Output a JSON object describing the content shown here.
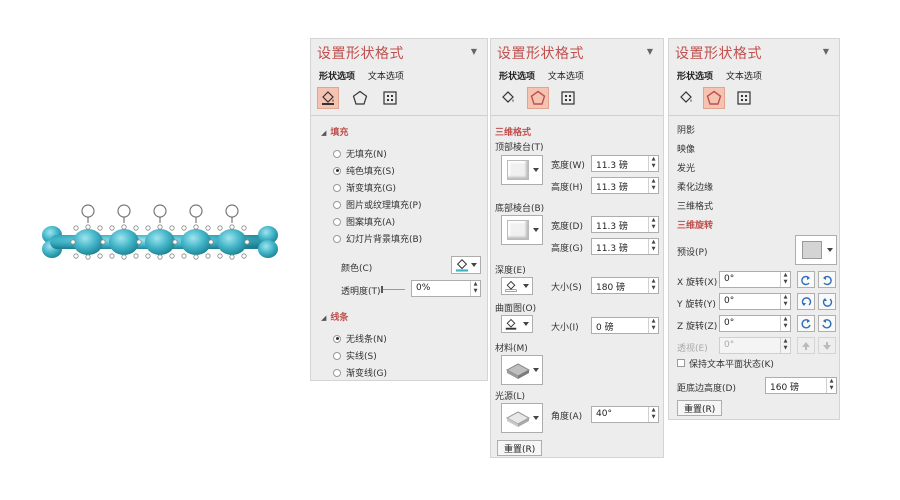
{
  "panel1": {
    "title": "设置形状格式",
    "tabs": [
      "形状选项",
      "文本选项"
    ],
    "fill": {
      "heading": "填充",
      "options": [
        "无填充(N)",
        "纯色填充(S)",
        "渐变填充(G)",
        "图片或纹理填充(P)",
        "图案填充(A)",
        "幻灯片背景填充(B)"
      ],
      "selected_index": 1,
      "color_label": "颜色(C)",
      "transparency_label": "透明度(T)",
      "transparency_value": "0%",
      "transparency_level": 0
    },
    "line": {
      "heading": "线条",
      "options": [
        "无线条(N)",
        "实线(S)",
        "渐变线(G)"
      ],
      "selected_index": 0
    }
  },
  "panel2": {
    "title": "设置形状格式",
    "tabs": [
      "形状选项",
      "文本选项"
    ],
    "section": "三维格式",
    "top_bevel": {
      "label": "顶部棱台(T)",
      "width_label": "宽度(W)",
      "width_value": "11.3 磅",
      "height_label": "高度(H)",
      "height_value": "11.3 磅"
    },
    "bottom_bevel": {
      "label": "底部棱台(B)",
      "width_label": "宽度(D)",
      "width_value": "11.3 磅",
      "height_label": "高度(G)",
      "height_value": "11.3 磅"
    },
    "depth": {
      "label": "深度(E)",
      "size_label": "大小(S)",
      "size_value": "180 磅"
    },
    "contour": {
      "label": "曲面图(O)",
      "size_label": "大小(I)",
      "size_value": "0 磅"
    },
    "material_label": "材料(M)",
    "lighting": {
      "label": "光源(L)",
      "angle_label": "角度(A)",
      "angle_value": "40°"
    },
    "reset_button": "重置(R)"
  },
  "panel3": {
    "title": "设置形状格式",
    "tabs": [
      "形状选项",
      "文本选项"
    ],
    "effects": [
      "阴影",
      "映像",
      "发光",
      "柔化边缘",
      "三维格式",
      "三维旋转"
    ],
    "active_effect_index": 5,
    "preset_label": "预设(P)",
    "x_rotation": {
      "label": "X 旋转(X)",
      "value": "0°"
    },
    "y_rotation": {
      "label": "Y 旋转(Y)",
      "value": "0°"
    },
    "z_rotation": {
      "label": "Z 旋转(Z)",
      "value": "0°"
    },
    "perspective": {
      "label": "透视(E)",
      "value": "0°"
    },
    "keep_text_flat_label": "保持文本平面状态(K)",
    "distance_label": "距底边高度(D)",
    "distance_value": "160 磅",
    "reset_button": "重置(R)"
  },
  "colors": {
    "accent": "#c0504d",
    "shape": "#3fb3c6",
    "panel_bg": "#ededed",
    "selected_icon_bg": "#f5c3b2"
  },
  "icons": [
    "fill-line-icon",
    "effects-pentagon-icon",
    "size-properties-icon",
    "rotate-handle-icon"
  ]
}
